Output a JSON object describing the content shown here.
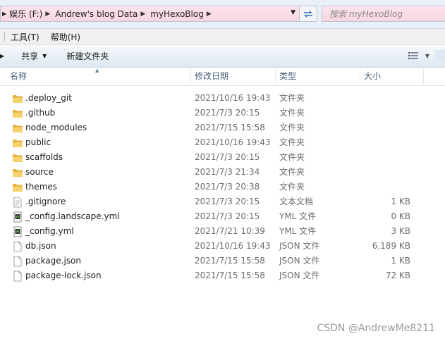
{
  "address": {
    "crumbs": [
      "娱乐 (F:)",
      "Andrew's blog Data",
      "myHexoBlog"
    ],
    "search_placeholder": "搜索 myHexoBlog"
  },
  "menu": {
    "items": [
      "工具(T)",
      "帮助(H)"
    ]
  },
  "toolbar": {
    "share": "共享",
    "new_folder": "新建文件夹"
  },
  "columns": {
    "name": "名称",
    "date": "修改日期",
    "type": "类型",
    "size": "大小"
  },
  "files": [
    {
      "name": ".deploy_git",
      "date": "2021/10/16 19:43",
      "type": "文件夹",
      "size": "",
      "icon": "folder-icon"
    },
    {
      "name": ".github",
      "date": "2021/7/3 20:15",
      "type": "文件夹",
      "size": "",
      "icon": "folder-icon"
    },
    {
      "name": "node_modules",
      "date": "2021/7/15 15:58",
      "type": "文件夹",
      "size": "",
      "icon": "folder-icon"
    },
    {
      "name": "public",
      "date": "2021/10/16 19:43",
      "type": "文件夹",
      "size": "",
      "icon": "folder-icon"
    },
    {
      "name": "scaffolds",
      "date": "2021/7/3 20:15",
      "type": "文件夹",
      "size": "",
      "icon": "folder-icon"
    },
    {
      "name": "source",
      "date": "2021/7/3 21:34",
      "type": "文件夹",
      "size": "",
      "icon": "folder-icon"
    },
    {
      "name": "themes",
      "date": "2021/7/3 20:38",
      "type": "文件夹",
      "size": "",
      "icon": "folder-icon"
    },
    {
      "name": ".gitignore",
      "date": "2021/7/3 20:15",
      "type": "文本文档",
      "size": "1 KB",
      "icon": "text-file-icon"
    },
    {
      "name": "_config.landscape.yml",
      "date": "2021/7/3 20:15",
      "type": "YML 文件",
      "size": "0 KB",
      "icon": "yml-file-icon"
    },
    {
      "name": "_config.yml",
      "date": "2021/7/21 10:39",
      "type": "YML 文件",
      "size": "3 KB",
      "icon": "yml-file-icon"
    },
    {
      "name": "db.json",
      "date": "2021/10/16 19:43",
      "type": "JSON 文件",
      "size": "6,189 KB",
      "icon": "blank-file-icon"
    },
    {
      "name": "package.json",
      "date": "2021/7/15 15:58",
      "type": "JSON 文件",
      "size": "1 KB",
      "icon": "blank-file-icon"
    },
    {
      "name": "package-lock.json",
      "date": "2021/7/15 15:58",
      "type": "JSON 文件",
      "size": "72 KB",
      "icon": "blank-file-icon"
    }
  ],
  "watermark": "CSDN @AndrewMe8211"
}
